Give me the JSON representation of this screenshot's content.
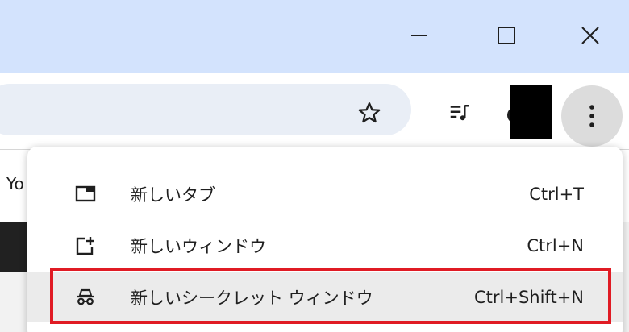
{
  "window_controls": {
    "minimize_icon": "minimize-icon",
    "maximize_icon": "maximize-icon",
    "close_icon": "close-icon"
  },
  "toolbar": {
    "bookmark_icon": "star-icon",
    "media_icon": "playlist-icon",
    "menu_icon": "three-dots-vertical-icon"
  },
  "page": {
    "snippet": "Yo"
  },
  "menu": {
    "items": [
      {
        "label": "新しいタブ",
        "shortcut": "Ctrl+T",
        "icon": "new-tab-icon"
      },
      {
        "label": "新しいウィンドウ",
        "shortcut": "Ctrl+N",
        "icon": "new-window-icon"
      },
      {
        "label": "新しいシークレット ウィンドウ",
        "shortcut": "Ctrl+Shift+N",
        "icon": "incognito-icon"
      }
    ]
  },
  "colors": {
    "titlebar": "#d3e3fd",
    "omnibox": "#e9eef6",
    "hover": "#ebebeb",
    "highlight_border": "#e01b24"
  }
}
